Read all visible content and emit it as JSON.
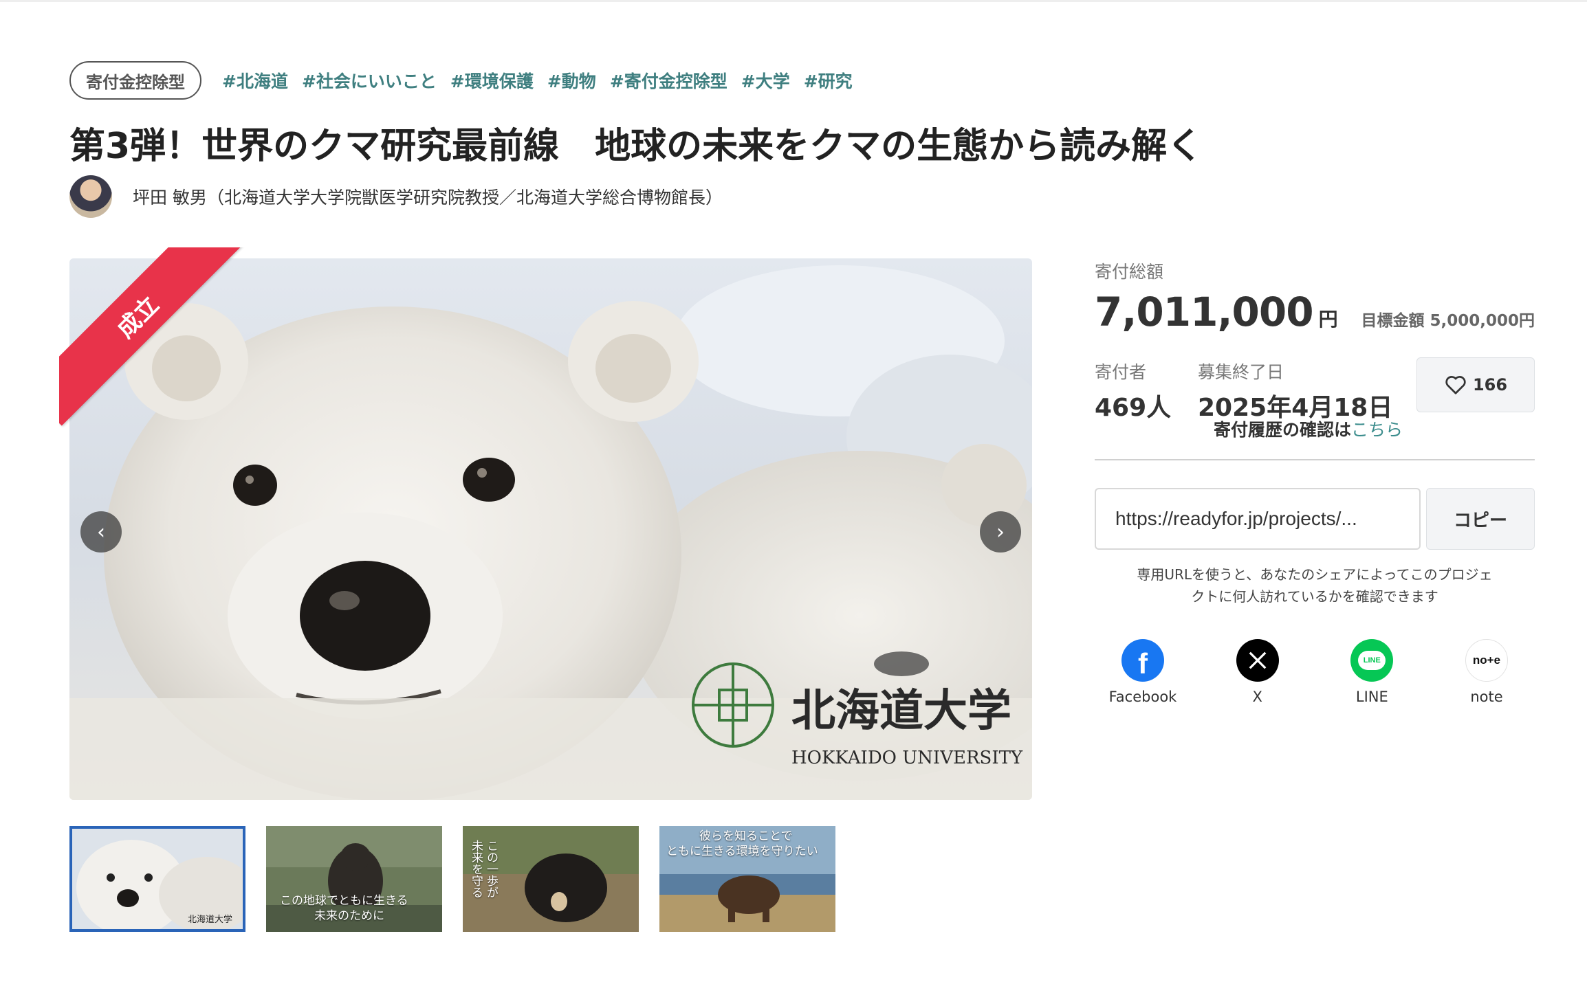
{
  "tags": {
    "badge": "寄付金控除型",
    "hashtags": [
      "#北海道",
      "#社会にいいこと",
      "#環境保護",
      "#動物",
      "#寄付金控除型",
      "#大学",
      "#研究"
    ]
  },
  "project": {
    "title": "第3弾！世界のクマ研究最前線　地球の未来をクマの生態から読み解く",
    "owner": "坪田 敏男（北海道大学大学院獣医学研究院教授／北海道大学総合博物館長）",
    "status_ribbon": "成立"
  },
  "hero": {
    "logo_jp": "北海道大学",
    "logo_en": "HOKKAIDO UNIVERSITY"
  },
  "thumbnails": [
    {
      "caption_lines": [],
      "logo": "北海道大学"
    },
    {
      "caption_lines": [
        "この地球でともに生きる",
        "未来のために"
      ]
    },
    {
      "caption_lines": [
        "この一歩が",
        "未来を守る"
      ]
    },
    {
      "caption_lines": [
        "彼らを知ることで",
        "ともに生きる環境を守りたい"
      ]
    }
  ],
  "funding": {
    "total_label": "寄付総額",
    "total_amount": "7,011,000",
    "currency": "円",
    "goal": "目標金額 5,000,000円",
    "supporters_label": "寄付者",
    "supporters": "469人",
    "end_label": "募集終了日",
    "end_date": "2025年4月18日",
    "favorite_count": "166",
    "history_text": "寄付履歴の確認は",
    "history_link": "こちら"
  },
  "share": {
    "url": "https://readyfor.jp/projects/...",
    "copy_label": "コピー",
    "note_line1": "専用URLを使うと、あなたのシェアによってこのプロジェ",
    "note_line2": "クトに何人訪れているかを確認できます",
    "networks": [
      {
        "label": "Facebook",
        "icon": "facebook-icon",
        "color": "#1877f2"
      },
      {
        "label": "X",
        "icon": "x-icon",
        "color": "#000000"
      },
      {
        "label": "LINE",
        "icon": "line-icon",
        "color": "#06c755"
      },
      {
        "label": "note",
        "icon": "note-icon",
        "color": "#ffffff"
      }
    ]
  },
  "colors": {
    "ribbon": "#e8334a",
    "hashtag": "#3f7f80",
    "link": "#3a8c8c",
    "active_thumb": "#2a64b8"
  }
}
